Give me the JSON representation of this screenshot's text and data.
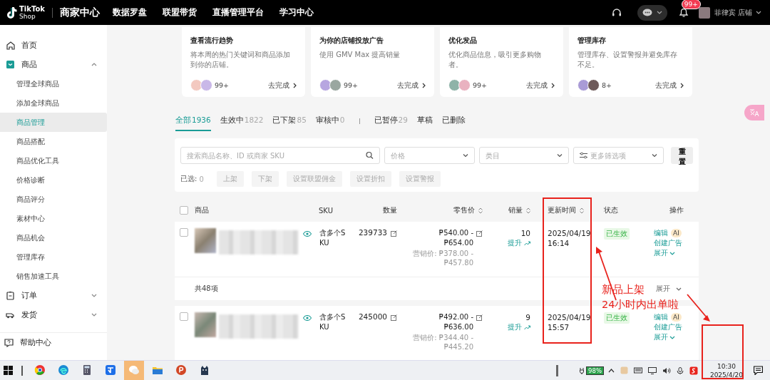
{
  "top_nav": {
    "logo": {
      "line1": "TikTok",
      "line2": "Shop"
    },
    "brand": "商家中心",
    "items": [
      "数据罗盘",
      "联盟带货",
      "直播管理平台",
      "学习中心"
    ],
    "notification_badge": "99+",
    "account": "菲律宾 店铺"
  },
  "sidebar": {
    "items": [
      {
        "label": "首页",
        "selected": false
      },
      {
        "label": "商品",
        "selected": false,
        "expanded": true,
        "children": [
          {
            "label": "管理全球商品",
            "selected": false
          },
          {
            "label": "添加全球商品",
            "selected": false
          },
          {
            "label": "商品管理",
            "selected": true
          },
          {
            "label": "商品搭配",
            "selected": false
          },
          {
            "label": "商品优化工具",
            "selected": false
          },
          {
            "label": "价格诊断",
            "selected": false
          },
          {
            "label": "商品评分",
            "selected": false
          },
          {
            "label": "素材中心",
            "selected": false
          },
          {
            "label": "商品机会",
            "selected": false
          },
          {
            "label": "管理库存",
            "selected": false
          },
          {
            "label": "销售加速工具",
            "selected": false
          }
        ]
      },
      {
        "label": "订单",
        "selected": false,
        "expanded": false
      },
      {
        "label": "发货",
        "selected": false,
        "expanded": false
      }
    ],
    "help": "帮助中心"
  },
  "tasks": [
    {
      "title": "查看流行趋势",
      "description": "将本周的热门关键词和商品添加到你的店铺。",
      "count": "99+",
      "action": "去完成"
    },
    {
      "title": "为你的店铺投放广告",
      "description": "使用 GMV Max 提高销量",
      "count": "99+",
      "action": "去完成"
    },
    {
      "title": "优化发品",
      "description": "优化商品信息，吸引更多购物者。",
      "count": "99+",
      "action": "去完成"
    },
    {
      "title": "管理库存",
      "description": "管理库存、设置警报并避免库存不足。",
      "count": "8+",
      "action": "去完成"
    }
  ],
  "tabs": [
    {
      "label": "全部",
      "count": "1936",
      "selected": true
    },
    {
      "label": "生效中",
      "count": "1822",
      "selected": false
    },
    {
      "label": "已下架",
      "count": "85",
      "selected": false
    },
    {
      "label": "审核中",
      "count": "0",
      "selected": false
    },
    {
      "label": "已暂停",
      "count": "29",
      "selected": false
    },
    {
      "label": "草稿",
      "selected": false
    },
    {
      "label": "已删除",
      "selected": false
    }
  ],
  "filters": {
    "search": {
      "placeholder": "搜索商品名称、ID 或商家 SKU"
    },
    "price": {
      "placeholder": "价格"
    },
    "category": {
      "placeholder": "类目"
    },
    "more": {
      "placeholder": "更多筛选项"
    },
    "reset": "重置"
  },
  "bulk": {
    "selected_label": "已选:",
    "selected_count": "0",
    "actions": [
      {
        "label": "上架",
        "disabled": true
      },
      {
        "label": "下架",
        "disabled": true
      },
      {
        "label": "设置联盟佣金",
        "disabled": true
      },
      {
        "label": "设置折扣",
        "disabled": true
      },
      {
        "label": "设置警报",
        "disabled": true
      }
    ]
  },
  "table": {
    "header_checked": false,
    "columns": [
      {
        "label": "商品",
        "sortable": false
      },
      {
        "label": "SKU",
        "sortable": false
      },
      {
        "label": "数量",
        "sortable": false
      },
      {
        "label": "零售价",
        "sortable": true
      },
      {
        "label": "销量",
        "sortable": true
      },
      {
        "label": "更新时间",
        "sortable": true
      },
      {
        "label": "状态",
        "sortable": false
      },
      {
        "label": "操作",
        "sortable": false
      }
    ],
    "rows": [
      {
        "kind": "product",
        "checked": false,
        "sku": [
          "含多个S",
          "KU"
        ],
        "quantity": "239733",
        "price": [
          "₱540.00 -",
          "₱654.00"
        ],
        "marketing_price": [
          "营销价: ₱378.00 -",
          "₱457.80"
        ],
        "sales": "10",
        "boost": "提升",
        "updated": [
          "2025/04/19",
          "16:14"
        ],
        "status": "已生效",
        "actions": {
          "edit": "编辑",
          "ai": "AI",
          "create_ad": "创建广告",
          "expand": "展开"
        }
      },
      {
        "kind": "summary",
        "total": "共48项",
        "expand": "展开"
      },
      {
        "kind": "product",
        "checked": false,
        "sku": [
          "含多个S",
          "KU"
        ],
        "quantity": "245000",
        "price": [
          "₱492.00 -",
          "₱636.00"
        ],
        "marketing_price": [
          "营销价: ₱344.40 -",
          "₱445.20"
        ],
        "sales": "9",
        "boost": "提升",
        "updated": [
          "2025/04/19",
          "15:57"
        ],
        "status": "已生效",
        "actions": {
          "edit": "编辑",
          "ai": "AI",
          "create_ad": "创建广告",
          "expand": "展开"
        }
      }
    ]
  },
  "annotation": [
    "新品上架",
    "24小时内出单啦"
  ],
  "taskbar": {
    "apps": [
      {
        "kind": "chrome",
        "active": false
      },
      {
        "kind": "edge",
        "active": false
      },
      {
        "kind": "calculator",
        "active": false
      },
      {
        "kind": "app",
        "active": false
      },
      {
        "kind": "wechat",
        "active": true
      },
      {
        "kind": "files",
        "active": false
      },
      {
        "kind": "slides",
        "active": false
      },
      {
        "kind": "cat",
        "active": false
      }
    ],
    "battery": "98%",
    "time": "10:30",
    "date": "2025/4/20"
  }
}
